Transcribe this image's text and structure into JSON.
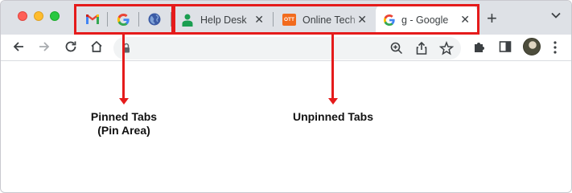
{
  "window": {
    "traffic_lights": [
      "close",
      "minimize",
      "zoom"
    ],
    "colors": {
      "close": "#ff5f57",
      "minimize": "#febc2e",
      "zoom": "#28c840",
      "annotation": "#e51b1b"
    }
  },
  "pinned_tabs": [
    {
      "icon": "gmail-icon"
    },
    {
      "icon": "google-icon"
    },
    {
      "icon": "globe-icon"
    }
  ],
  "tabs": [
    {
      "title": "Help Desk",
      "icon": "helpdesk-person-icon",
      "close": "✕",
      "active": false
    },
    {
      "title": "Online Tech",
      "icon": "ott-icon",
      "icon_text": "OTT",
      "close": "✕",
      "active": false
    },
    {
      "title": "g - Google",
      "icon": "google-icon",
      "close": "✕",
      "active": true
    }
  ],
  "new_tab_label": "+",
  "toolbar": {
    "address": {
      "value": ""
    }
  },
  "annotations": {
    "pinned": {
      "line1": "Pinned Tabs",
      "line2": "(Pin Area)"
    },
    "unpinned": {
      "label": "Unpinned Tabs"
    }
  }
}
